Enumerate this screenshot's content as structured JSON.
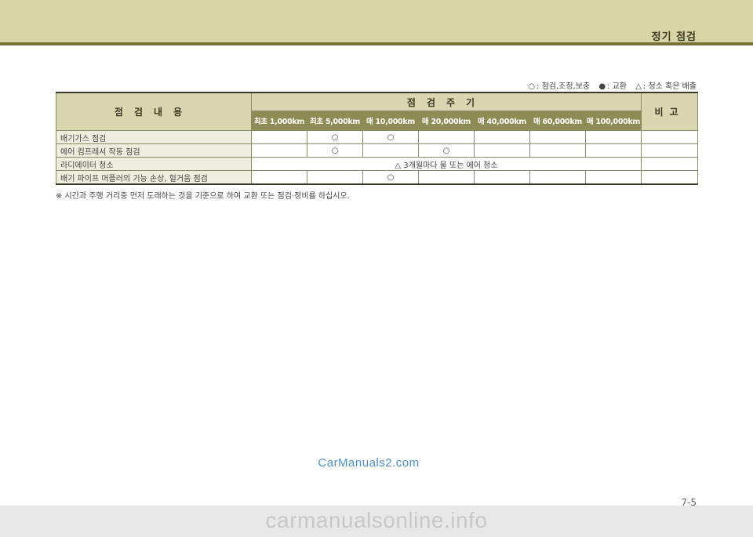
{
  "header": {
    "section_title": "정기 점검"
  },
  "legend": {
    "inspect_symbol": "○",
    "inspect_label": ": 점검,조정,보충",
    "replace_symbol": "●",
    "replace_label": ": 교환",
    "clean_symbol": "△",
    "clean_label": ": 청소 혹은 배출"
  },
  "table": {
    "col_content": "점검내용",
    "col_period": "점검주기",
    "col_note": "비고",
    "intervals": [
      "최초 1,000km",
      "최초 5,000km",
      "매 10,000km",
      "매 20,000km",
      "매 40,000km",
      "매 60,000km",
      "매 100,000km"
    ],
    "rows": [
      {
        "item": "배기가스 점검",
        "marks": [
          "",
          "○",
          "○",
          "",
          "",
          "",
          ""
        ],
        "note": ""
      },
      {
        "item": "에어 컴프레서 작동 점검",
        "marks": [
          "",
          "○",
          "",
          "○",
          "",
          "",
          ""
        ],
        "note": ""
      },
      {
        "item": "라디에이터 청소",
        "span_text": "△ 3개월마다 물 또는 에어 청소",
        "note": ""
      },
      {
        "item": "배기 파이프 머플러의 기능 손상, 헐거움 점검",
        "marks": [
          "",
          "",
          "○",
          "",
          "",
          "",
          ""
        ],
        "note": ""
      }
    ]
  },
  "footnote": "※ 시간과 주행 거리중 먼저 도래하는 것을 기준으로 하여 교환 또는 점검·정비를 하십시오.",
  "watermark": "CarManuals2.com",
  "page_number": "7-5",
  "bottom_watermark": "carmanualsonline.info"
}
